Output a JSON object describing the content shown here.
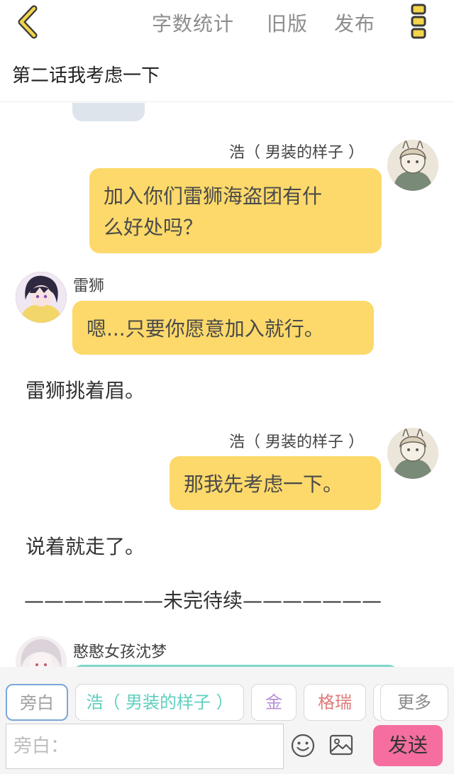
{
  "header": {
    "actions": [
      "字数统计",
      "旧版",
      "发布"
    ],
    "chapter_title": "第二话我考虑一下"
  },
  "chat": {
    "partial_bubble_text": "（ ）",
    "messages": [
      {
        "speaker": "浩（ 男装的样子 ）",
        "lines": [
          "加入你们雷狮海盗团有什",
          "么好处吗？"
        ]
      },
      {
        "speaker": "雷狮",
        "lines": [
          "嗯...只要你愿意加入就行。"
        ]
      },
      {
        "narration": "雷狮挑着眉。"
      },
      {
        "speaker": "浩（ 男装的样子 ）",
        "lines": [
          "那我先考虑一下。"
        ]
      },
      {
        "narration": "说着就走了。"
      },
      {
        "divider": "———————未完待续———————"
      },
      {
        "speaker": "憨憨女孩沈梦"
      }
    ]
  },
  "roles": [
    "旁白",
    "浩（ 男装的样子 ）",
    "金",
    "格瑞",
    "更多"
  ],
  "role_colors": {
    "旁白": "#a0a0a0",
    "浩": "#5fcfbf",
    "金": "#b78fd8",
    "格瑞": "#e07a7a",
    "更多": "#8a8a8a"
  },
  "input": {
    "placeholder": "旁白："
  },
  "send_label": "发送",
  "icons": {
    "back": "chevron-left-icon",
    "more": "vertical-dots-icon",
    "emoji": "smiley-icon",
    "image": "image-icon"
  },
  "colors": {
    "accent_yellow": "#f3d54a",
    "bubble_yellow": "#fcd96a",
    "send_pink": "#f56e9f"
  }
}
